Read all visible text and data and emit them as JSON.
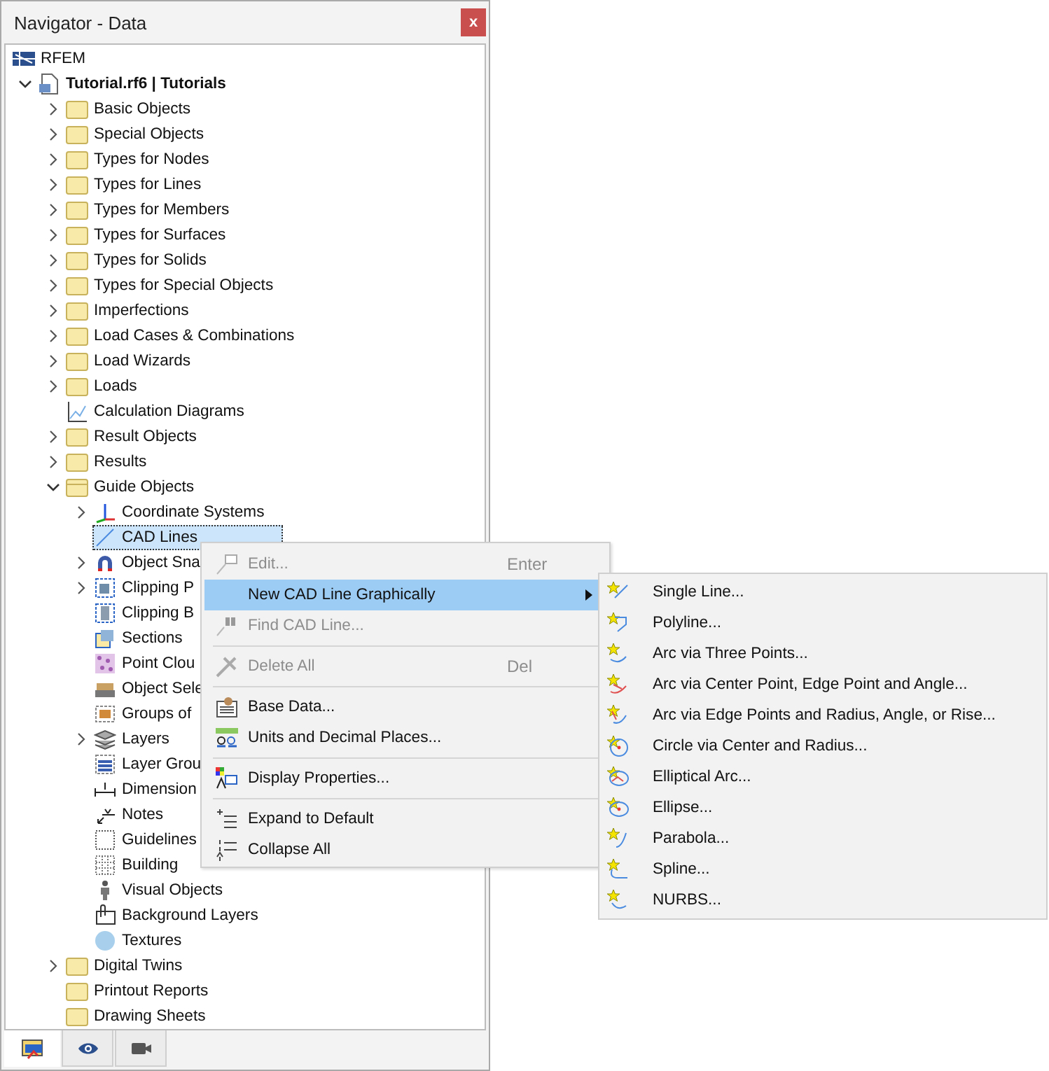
{
  "window": {
    "title": "Navigator - Data",
    "close": "x"
  },
  "root": {
    "label": "RFEM",
    "kind": "rfem",
    "selected": false
  },
  "tree": [
    {
      "label": "**Tutorial.rf6 | Tutorials**",
      "kind": "file",
      "expanded": true,
      "selected": false,
      "children": [
        {
          "label": "Basic Objects",
          "kind": "folder",
          "expanded": false,
          "selected": false
        },
        {
          "label": "Special Objects",
          "kind": "folder",
          "expanded": false,
          "selected": false
        },
        {
          "label": "Types for Nodes",
          "kind": "folder",
          "expanded": false,
          "selected": false
        },
        {
          "label": "Types for Lines",
          "kind": "folder",
          "expanded": false,
          "selected": false
        },
        {
          "label": "Types for Members",
          "kind": "folder",
          "expanded": false,
          "selected": false
        },
        {
          "label": "Types for Surfaces",
          "kind": "folder",
          "expanded": false,
          "selected": false
        },
        {
          "label": "Types for Solids",
          "kind": "folder",
          "expanded": false,
          "selected": false
        },
        {
          "label": "Types for Special Objects",
          "kind": "folder",
          "expanded": false,
          "selected": false
        },
        {
          "label": "Imperfections",
          "kind": "folder",
          "expanded": false,
          "selected": false
        },
        {
          "label": "Load Cases & Combinations",
          "kind": "folder",
          "expanded": false,
          "selected": false
        },
        {
          "label": "Load Wizards",
          "kind": "folder",
          "expanded": false,
          "selected": false
        },
        {
          "label": "Loads",
          "kind": "folder",
          "expanded": false,
          "selected": false
        },
        {
          "label": "Calculation Diagrams",
          "kind": "diagram",
          "selected": false
        },
        {
          "label": "Result Objects",
          "kind": "folder",
          "expanded": false,
          "selected": false
        },
        {
          "label": "Results",
          "kind": "folder",
          "expanded": false,
          "selected": false
        },
        {
          "label": "Guide Objects",
          "kind": "openfolder",
          "expanded": true,
          "selected": false,
          "children": [
            {
              "label": "Coordinate Systems",
              "kind": "axes",
              "expanded": false,
              "selected": false
            },
            {
              "label": "CAD Lines",
              "kind": "cadline",
              "selected": true
            },
            {
              "label": "Object Sna",
              "kind": "magnet",
              "expanded": false,
              "selected": false
            },
            {
              "label": "Clipping P",
              "kind": "clipplane",
              "expanded": false,
              "selected": false
            },
            {
              "label": "Clipping B",
              "kind": "clipbox",
              "selected": false
            },
            {
              "label": "Sections",
              "kind": "section",
              "selected": false
            },
            {
              "label": "Point Clou",
              "kind": "pointcloud",
              "selected": false
            },
            {
              "label": "Object Sele",
              "kind": "objsel",
              "selected": false
            },
            {
              "label": "Groups of",
              "kind": "groups",
              "selected": false
            },
            {
              "label": "Layers",
              "kind": "layers",
              "expanded": false,
              "selected": false
            },
            {
              "label": "Layer Grou",
              "kind": "layergroup",
              "selected": false
            },
            {
              "label": "Dimension",
              "kind": "dimension",
              "selected": false
            },
            {
              "label": "Notes",
              "kind": "notes",
              "selected": false
            },
            {
              "label": "Guidelines",
              "kind": "guidelines",
              "selected": false
            },
            {
              "label": "Building",
              "kind": "grid",
              "selected": false
            },
            {
              "label": "Visual Objects",
              "kind": "person",
              "selected": false
            },
            {
              "label": "Background Layers",
              "kind": "bglayer",
              "selected": false
            },
            {
              "label": "Textures",
              "kind": "texture",
              "selected": false
            }
          ]
        },
        {
          "label": "Digital Twins",
          "kind": "folder",
          "expanded": false,
          "selected": false
        },
        {
          "label": "Printout Reports",
          "kind": "folder",
          "selected": false
        },
        {
          "label": "Drawing Sheets",
          "kind": "folder",
          "selected": false
        }
      ]
    }
  ],
  "context_menu": [
    {
      "kind": "item",
      "label": "Edit...",
      "shortcut": "Enter",
      "disabled": true,
      "selected": false
    },
    {
      "kind": "submenu",
      "label": "New CAD Line Graphically",
      "disabled": false,
      "selected": true
    },
    {
      "kind": "item",
      "label": "Find CAD Line...",
      "disabled": true,
      "selected": false
    },
    {
      "kind": "separator"
    },
    {
      "kind": "item",
      "label": "Delete All",
      "shortcut": "Del",
      "disabled": true,
      "selected": false
    },
    {
      "kind": "separator"
    },
    {
      "kind": "item",
      "label": "Base Data...",
      "disabled": false,
      "selected": false
    },
    {
      "kind": "item",
      "label": "Units and Decimal Places...",
      "disabled": false,
      "selected": false
    },
    {
      "kind": "separator"
    },
    {
      "kind": "item",
      "label": "Display Properties...",
      "disabled": false,
      "selected": false
    },
    {
      "kind": "separator"
    },
    {
      "kind": "item",
      "label": "Expand to Default",
      "disabled": false,
      "selected": false
    },
    {
      "kind": "item",
      "label": "Collapse All",
      "disabled": false,
      "selected": false
    }
  ],
  "submenu": [
    {
      "label": "Single Line..."
    },
    {
      "label": "Polyline..."
    },
    {
      "label": "Arc via Three Points..."
    },
    {
      "label": "Arc via Center Point, Edge Point and Angle..."
    },
    {
      "label": "Arc via Edge Points and Radius, Angle, or Rise..."
    },
    {
      "label": "Circle via Center and Radius..."
    },
    {
      "label": "Elliptical Arc..."
    },
    {
      "label": "Ellipse..."
    },
    {
      "label": "Parabola..."
    },
    {
      "label": "Spline..."
    },
    {
      "label": "NURBS..."
    }
  ],
  "bottom_tabs": [
    {
      "selected": true
    },
    {
      "selected": false
    },
    {
      "selected": false
    }
  ]
}
